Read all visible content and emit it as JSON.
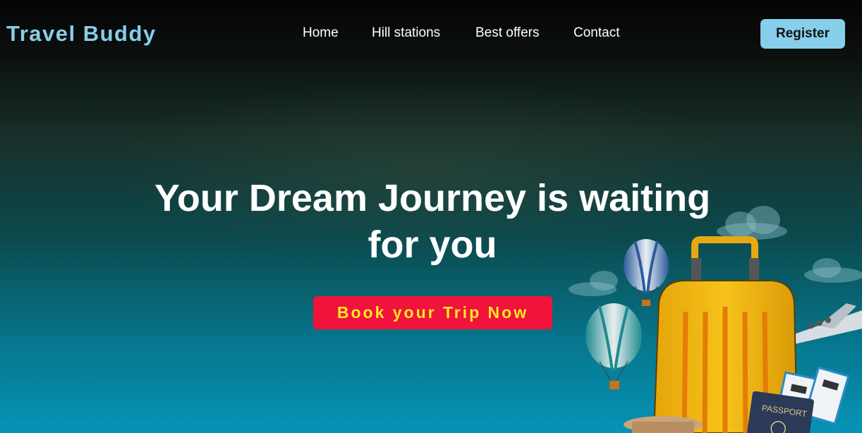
{
  "brand": {
    "name": "Travel Buddy"
  },
  "nav": {
    "items": [
      {
        "label": "Home"
      },
      {
        "label": "Hill stations"
      },
      {
        "label": "Best offers"
      },
      {
        "label": "Contact"
      }
    ],
    "register_label": "Register"
  },
  "hero": {
    "title": "Your Dream Journey is waiting for you",
    "cta_label": "Book your Trip Now"
  },
  "illustration": {
    "passport_label": "PASSPORT"
  },
  "colors": {
    "brand": "#87ceeb",
    "cta_background": "#f0133b",
    "cta_text": "#ffe924",
    "register_background": "#87ceeb"
  }
}
